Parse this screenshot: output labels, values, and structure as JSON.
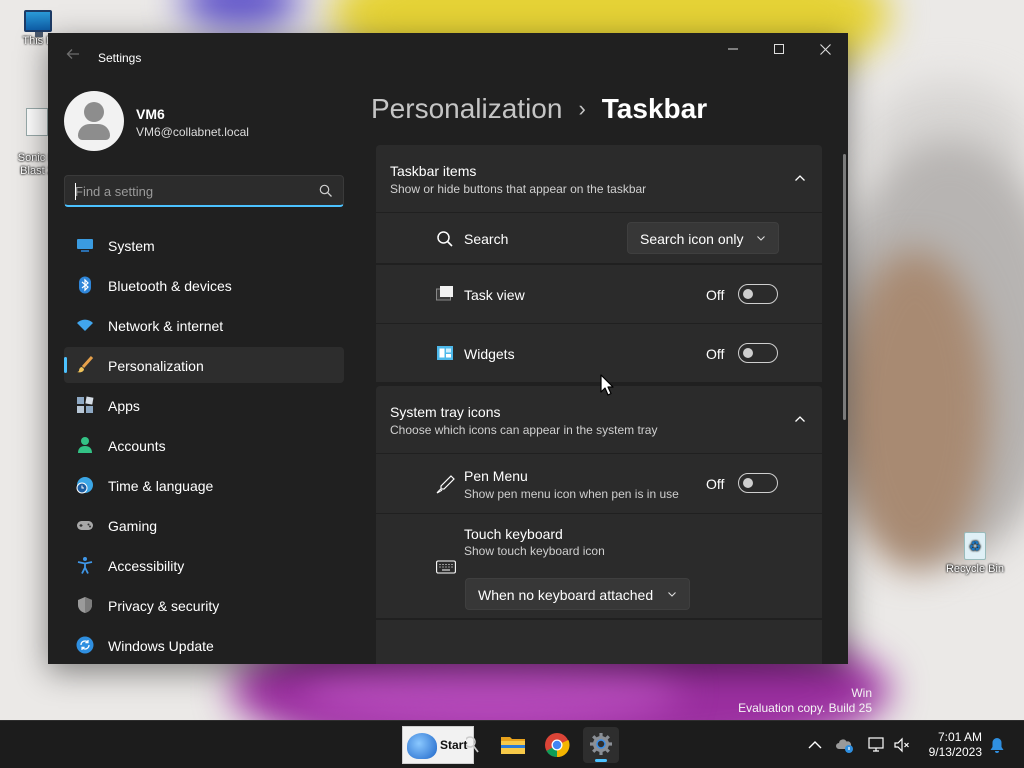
{
  "desktop": {
    "icons": [
      {
        "label": "This P",
        "icon": "this-pc-icon"
      },
      {
        "label": "Sonic R\nBlast 2",
        "icon": "shortcut-icon"
      },
      {
        "label": "Recycle Bin",
        "icon": "recycle-bin-icon"
      }
    ],
    "watermark": {
      "line1": "Win",
      "line2": "Evaluation copy. Build 25"
    }
  },
  "window": {
    "title": "Settings",
    "controls": {
      "minimize": "minimize-icon",
      "maximize": "maximize-icon",
      "close": "close-icon"
    }
  },
  "profile": {
    "name": "VM6",
    "email": "VM6@collabnet.local"
  },
  "search": {
    "placeholder": "Find a setting",
    "value": ""
  },
  "sidebar": {
    "items": [
      {
        "label": "System",
        "icon": "system-icon",
        "color": "#3a9be0"
      },
      {
        "label": "Bluetooth & devices",
        "icon": "bluetooth-icon",
        "color": "#2f86d9"
      },
      {
        "label": "Network & internet",
        "icon": "wifi-icon",
        "color": "#41a6ee"
      },
      {
        "label": "Personalization",
        "icon": "brush-icon",
        "color": "#e6a04a",
        "selected": true
      },
      {
        "label": "Apps",
        "icon": "apps-icon",
        "color": "#8ea9c4"
      },
      {
        "label": "Accounts",
        "icon": "person-icon",
        "color": "#33c285"
      },
      {
        "label": "Time & language",
        "icon": "globe-clock-icon",
        "color": "#3ba6e6"
      },
      {
        "label": "Gaming",
        "icon": "gamepad-icon",
        "color": "#a8a8a8"
      },
      {
        "label": "Accessibility",
        "icon": "accessibility-icon",
        "color": "#3f97e8"
      },
      {
        "label": "Privacy & security",
        "icon": "shield-icon",
        "color": "#9b9b9b"
      },
      {
        "label": "Windows Update",
        "icon": "sync-icon",
        "color": "#2f8fe0"
      }
    ]
  },
  "breadcrumb": {
    "parent": "Personalization",
    "separator": "›",
    "current": "Taskbar"
  },
  "sections": {
    "taskbar_items": {
      "title": "Taskbar items",
      "subtitle": "Show or hide buttons that appear on the taskbar",
      "rows": {
        "search": {
          "label": "Search",
          "dropdown_value": "Search icon only"
        },
        "task_view": {
          "label": "Task view",
          "state": "Off",
          "on": false
        },
        "widgets": {
          "label": "Widgets",
          "state": "Off",
          "on": false
        }
      }
    },
    "system_tray": {
      "title": "System tray icons",
      "subtitle": "Choose which icons can appear in the system tray",
      "rows": {
        "pen_menu": {
          "label": "Pen Menu",
          "description": "Show pen menu icon when pen is in use",
          "state": "Off",
          "on": false
        },
        "touch_keyboard": {
          "label": "Touch keyboard",
          "description": "Show touch keyboard icon",
          "dropdown_value": "When no keyboard attached"
        }
      }
    }
  },
  "taskbar": {
    "start_label": "Start",
    "apps": [
      "search-icon",
      "file-explorer-icon",
      "chrome-icon",
      "settings-icon"
    ],
    "tray": [
      "chevron-up-icon",
      "onedrive-icon",
      "network-icon",
      "volume-muted-icon",
      "notifications-icon"
    ],
    "time": "7:01 AM",
    "date": "9/13/2023"
  },
  "colors": {
    "accent": "#4cc2ff",
    "window_bg": "#202020",
    "card_bg": "#2b2b2b"
  }
}
